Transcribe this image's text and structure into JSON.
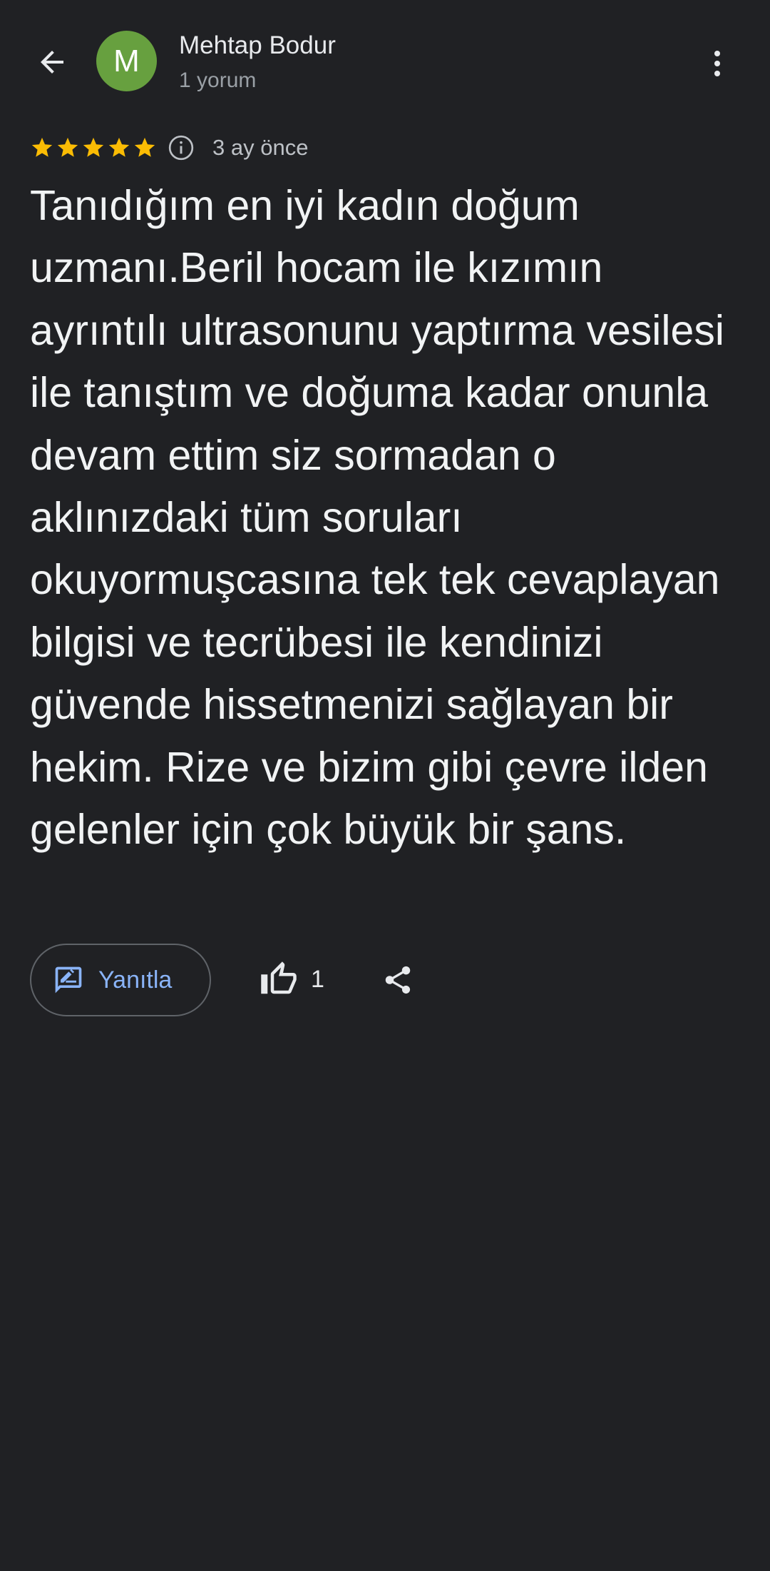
{
  "header": {
    "back_icon": "arrow-back-icon",
    "avatar_letter": "M",
    "avatar_color": "#67a03f",
    "author_name": "Mehtap Bodur",
    "author_meta": "1 yorum",
    "more_icon": "more-vert-icon"
  },
  "review": {
    "rating": 5,
    "rating_max": 5,
    "star_color": "#fbbc04",
    "date": "3 ay önce",
    "text": "Tanıdığım en iyi kadın doğum uzmanı.Beril hocam ile kızımın ayrıntılı ultrasonunu yaptırma vesilesi ile tanıştım ve doğuma kadar onunla devam ettim siz sormadan o aklınızdaki tüm soruları okuyormuşcasına tek tek cevaplayan bilgisi ve tecrübesi ile kendinizi güvende hissetmenizi sağlayan bir hekim. Rize ve bizim gibi çevre ilden gelenler için çok büyük bir şans."
  },
  "actions": {
    "reply_label": "Yanıtla",
    "reply_icon": "rate-review-icon",
    "like_icon": "thumb-up-icon",
    "like_count": "1",
    "share_icon": "share-icon",
    "accent_color": "#8ab4f8"
  }
}
